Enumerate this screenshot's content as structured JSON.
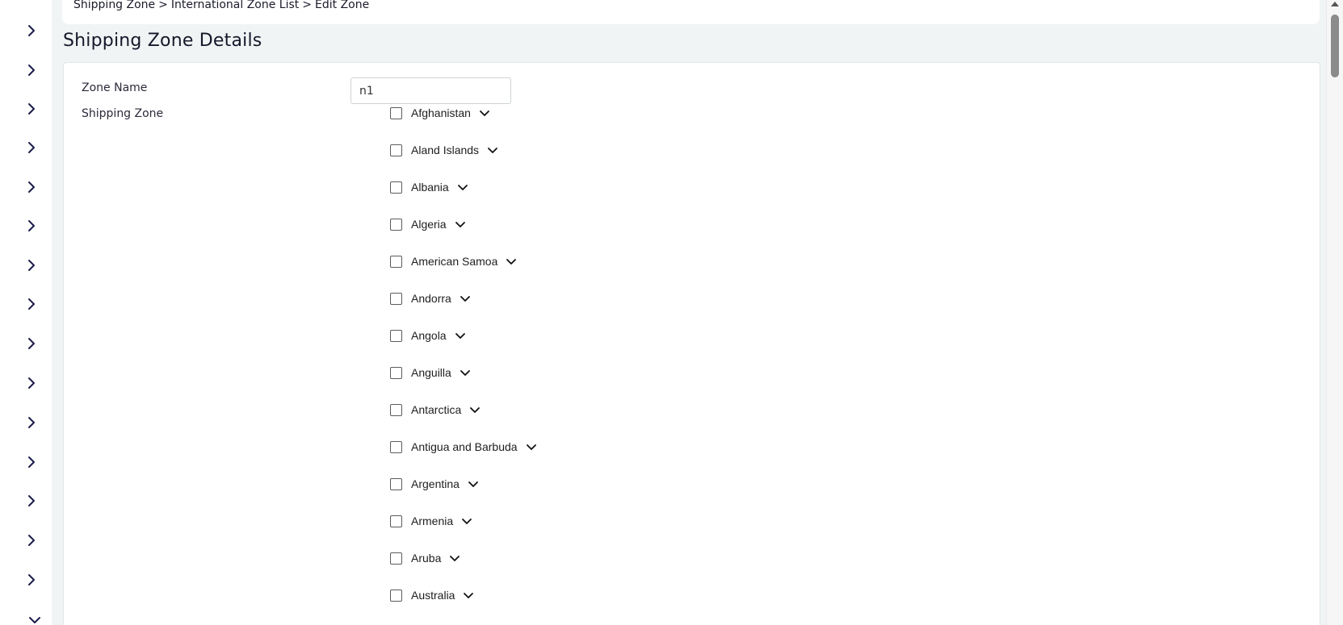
{
  "breadcrumb": {
    "items": [
      "Shipping Zone",
      "International Zone List",
      "Edit Zone"
    ],
    "separator": ">"
  },
  "page_title": "Shipping Zone Details",
  "form": {
    "zone_name_label": "Zone Name",
    "zone_name_value": "n1",
    "shipping_zone_label": "Shipping Zone"
  },
  "countries": [
    "Afghanistan",
    "Aland Islands",
    "Albania",
    "Algeria",
    "American Samoa",
    "Andorra",
    "Angola",
    "Anguilla",
    "Antarctica",
    "Antigua and Barbuda",
    "Argentina",
    "Armenia",
    "Aruba",
    "Australia"
  ],
  "icons": {
    "sidebar_toggle": "chevron-right-icon",
    "sidebar_last_toggle": "chevron-down-icon",
    "country_expand": "chevron-down-icon"
  },
  "colors": {
    "page_background": "#f1f4f4",
    "sidebar_icon": "#1c1c4a",
    "text": "#17172a"
  }
}
